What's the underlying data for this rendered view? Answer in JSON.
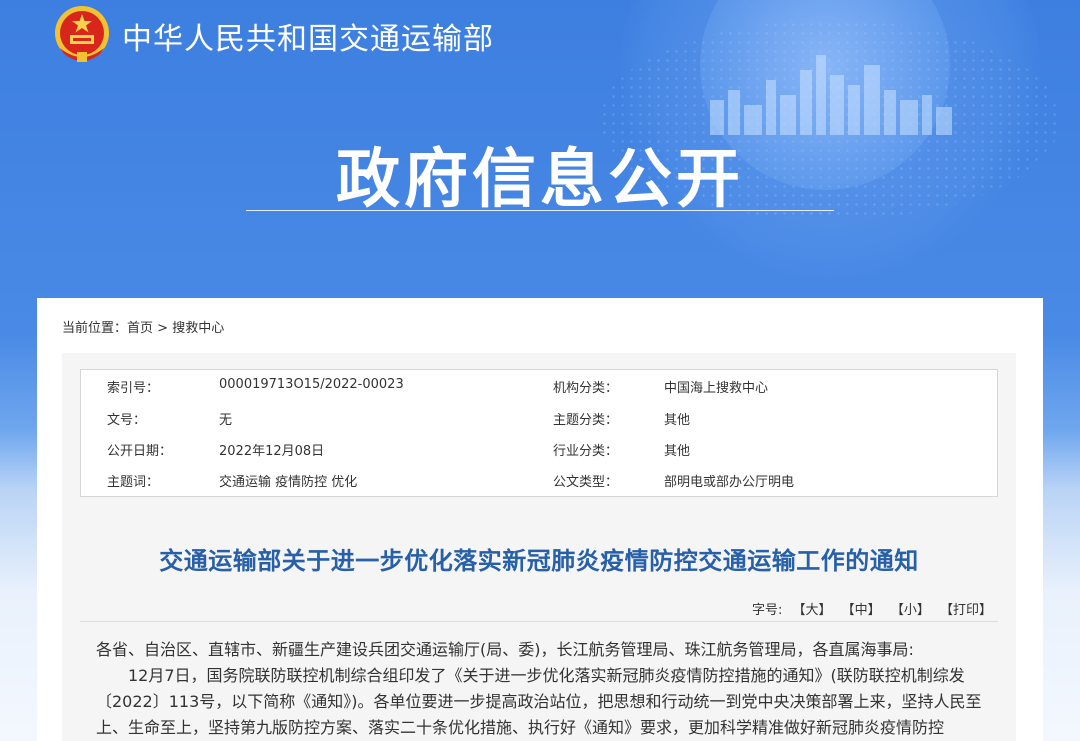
{
  "header": {
    "ministry_name": "中华人民共和国交通运输部",
    "banner_title": "政府信息公开"
  },
  "breadcrumb": {
    "prefix": "当前位置：",
    "home": "首页",
    "separator": " > ",
    "current": "搜救中心"
  },
  "meta": {
    "rows": [
      {
        "k1": "索引号：",
        "v1": "000019713O15/2022-00023",
        "k2": "机构分类：",
        "v2": "中国海上搜救中心"
      },
      {
        "k1": "文号：",
        "v1": "无",
        "k2": "主题分类：",
        "v2": "其他"
      },
      {
        "k1": "公开日期：",
        "v1": "2022年12月08日",
        "k2": "行业分类：",
        "v2": "其他"
      },
      {
        "k1": "主题词：",
        "v1": "交通运输 疫情防控 优化",
        "k2": "公文类型：",
        "v2": "部明电或部办公厅明电"
      }
    ]
  },
  "document": {
    "title": "交通运输部关于进一步优化落实新冠肺炎疫情防控交通运输工作的通知",
    "font_size_label": "字号:",
    "size_large": "【大】",
    "size_medium": "【中】",
    "size_small": "【小】",
    "print": "【打印】",
    "paragraph1": "各省、自治区、直辖市、新疆生产建设兵团交通运输厅(局、委)，长江航务管理局、珠江航务管理局，各直属海事局:",
    "paragraph2": "12月7日，国务院联防联控机制综合组印发了《关于进一步优化落实新冠肺炎疫情防控措施的通知》(联防联控机制综发〔2022〕113号，以下简称《通知》)。各单位要进一步提高政治站位，把思想和行动统一到党中央决策部署上来，坚持人民至上、生命至上，坚持第九版防控方案、落实二十条优化措施、执行好《通知》要求，更加科学精准做好新冠肺炎疫情防控"
  },
  "colors": {
    "banner_blue": "#3d7fe0",
    "title_blue": "#2760a9"
  }
}
